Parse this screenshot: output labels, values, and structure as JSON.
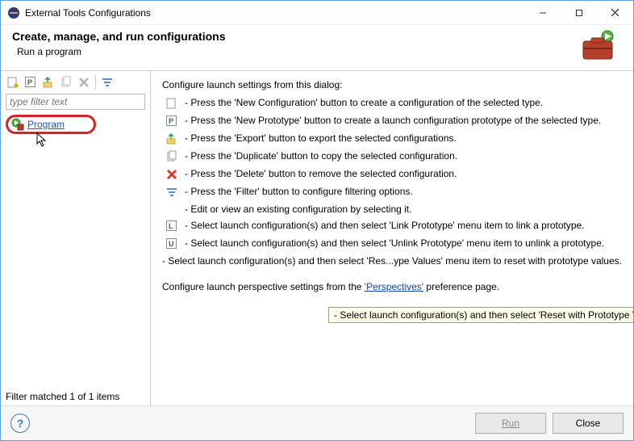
{
  "titlebar": {
    "title": "External Tools Configurations"
  },
  "header": {
    "title": "Create, manage, and run configurations",
    "subtitle": "Run a program"
  },
  "left": {
    "filter_placeholder": "type filter text",
    "tree_item_label": "Program",
    "status": "Filter matched 1 of 1 items"
  },
  "right": {
    "intro": "Configure launch settings from this dialog:",
    "lines": {
      "new_config": "- Press the 'New Configuration' button to create a configuration of the selected type.",
      "new_proto": "- Press the 'New Prototype' button to create a launch configuration prototype of the selected type.",
      "export": "- Press the 'Export' button to export the selected configurations.",
      "duplicate": "- Press the 'Duplicate' button to copy the selected configuration.",
      "delete": "- Press the 'Delete' button to remove the selected configuration.",
      "filter": "- Press the 'Filter' button to configure filtering options.",
      "edit": "- Edit or view an existing configuration by selecting it.",
      "link": "- Select launch configuration(s) and then select 'Link Prototype' menu item to link a prototype.",
      "unlink": "- Select launch configuration(s) and then select 'Unlink Prototype' menu item to unlink a prototype.",
      "reset": "- Select launch configuration(s) and then select 'Res...ype Values' menu item to reset with prototype values."
    },
    "tooltip": "- Select launch configuration(s) and then select 'Reset with Prototype Values' menu item to r",
    "perspectives_prefix": "Configure launch perspective settings from the ",
    "perspectives_link": "'Perspectives'",
    "perspectives_suffix": " preference page."
  },
  "buttons": {
    "run": "Run",
    "close": "Close"
  }
}
